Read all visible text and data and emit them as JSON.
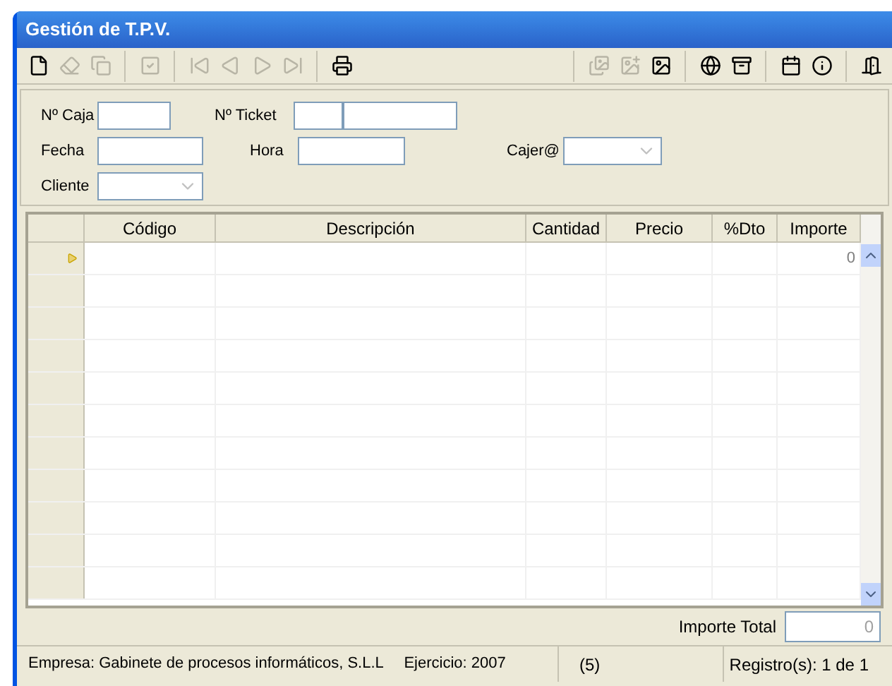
{
  "window": {
    "title": "Gestión de T.P.V."
  },
  "toolbar": [
    {
      "kind": "button",
      "disabled": false
    },
    {
      "kind": "button",
      "disabled": true
    },
    {
      "kind": "button",
      "disabled": true
    },
    {
      "kind": "separator"
    },
    {
      "kind": "button",
      "disabled": true
    },
    {
      "kind": "separator"
    },
    {
      "kind": "button",
      "disabled": true
    },
    {
      "kind": "button",
      "disabled": true
    },
    {
      "kind": "button",
      "disabled": true
    },
    {
      "kind": "button",
      "disabled": true
    },
    {
      "kind": "separator"
    },
    {
      "kind": "button",
      "disabled": false
    },
    {
      "kind": "spacer"
    },
    {
      "kind": "separator"
    },
    {
      "kind": "button",
      "disabled": true
    },
    {
      "kind": "button",
      "disabled": true
    },
    {
      "kind": "button",
      "disabled": false
    },
    {
      "kind": "separator"
    },
    {
      "kind": "button",
      "disabled": false
    },
    {
      "kind": "button",
      "disabled": false
    },
    {
      "kind": "separator"
    },
    {
      "kind": "button",
      "disabled": false
    },
    {
      "kind": "button",
      "disabled": false
    },
    {
      "kind": "separator"
    },
    {
      "kind": "button",
      "disabled": false
    }
  ],
  "form": {
    "caja_label": "Nº Caja",
    "ticket_label": "Nº Ticket",
    "fecha_label": "Fecha",
    "hora_label": "Hora",
    "cajero_label": "Cajer@",
    "cliente_label": "Cliente"
  },
  "table": {
    "columns": [
      "Código",
      "Descripción",
      "Cantidad",
      "Precio",
      "%Dto",
      "Importe"
    ],
    "rows": [
      {
        "current": true,
        "importe": "0"
      }
    ]
  },
  "total": {
    "label": "Importe Total",
    "value": "0"
  },
  "status_bar": [
    "Empresa: Gabinete de procesos informáticos, S.L.L",
    "Ejercicio: 2007",
    "(5)",
    "Registro(s): 1 de 1"
  ]
}
